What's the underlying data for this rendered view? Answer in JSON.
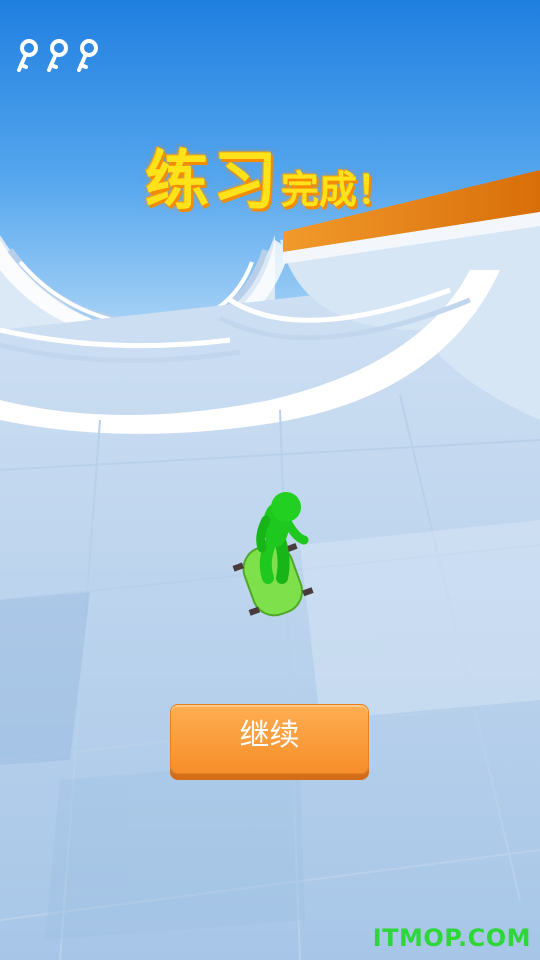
{
  "hud": {
    "keys": [
      "key-icon",
      "key-icon",
      "key-icon"
    ],
    "key_color": "#ffffff"
  },
  "result": {
    "title_main": "练习",
    "title_sub": "完成！"
  },
  "actions": {
    "continue_label": "继续",
    "button_color": "#f8962f"
  },
  "watermark": {
    "text": "ITMOP.COM",
    "color": "#2fd63a"
  },
  "colors": {
    "sky": "#3a8ce0",
    "track": "#c9dcf1",
    "rail_orange": "#e07a10",
    "player": "#1ec81e",
    "skateboard": "#7ee04a"
  }
}
